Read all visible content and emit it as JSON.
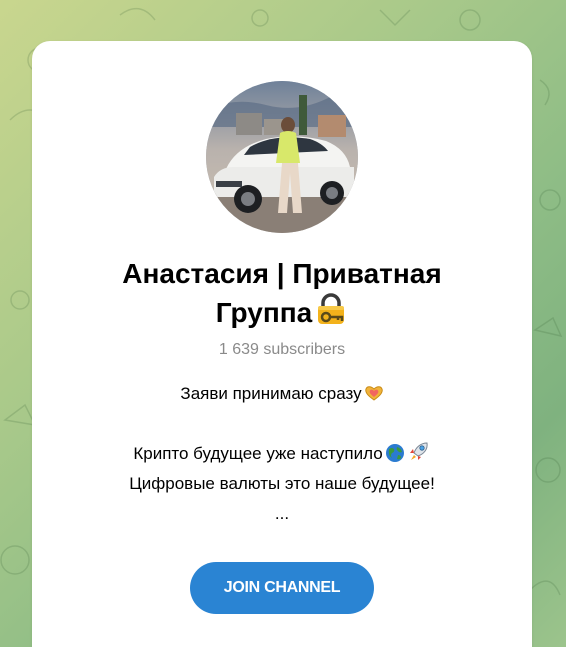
{
  "channel": {
    "title_line1": "Анастасия | Приватная",
    "title_line2": "Группа",
    "title_emoji": "lock-with-key-icon",
    "subscribers": "1 639 subscribers",
    "description": {
      "line1": "Заяви принимаю сразу",
      "line1_emoji": "heart-hands-icon",
      "line2": "Крипто будущее уже наступило",
      "line2_emojis": [
        "globe-icon",
        "rocket-icon"
      ],
      "line3": "Цифровые валюты это наше будущее!",
      "line4": "..."
    },
    "join_label": "JOIN CHANNEL"
  },
  "colors": {
    "accent": "#2a84d3",
    "subtitle": "#8a8a8a",
    "background_start": "#c9d68e",
    "background_end": "#7fb27f"
  }
}
